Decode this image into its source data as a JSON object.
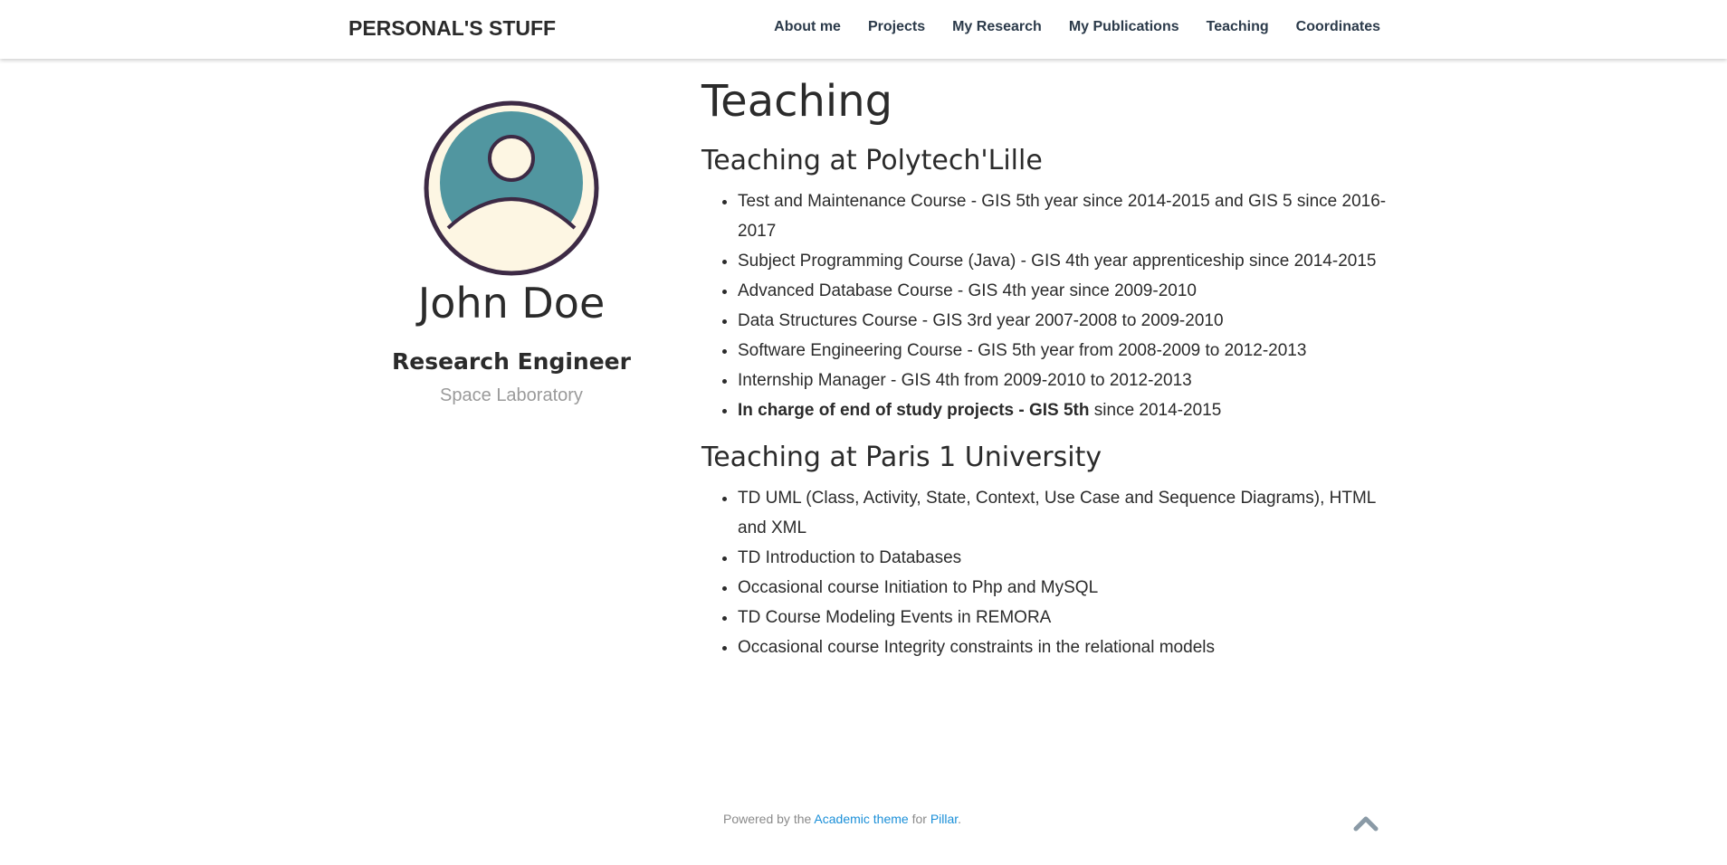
{
  "navbar": {
    "brand": "PERSONAL'S STUFF",
    "links": [
      {
        "label": "About me"
      },
      {
        "label": "Projects"
      },
      {
        "label": "My Research"
      },
      {
        "label": "My Publications"
      },
      {
        "label": "Teaching"
      },
      {
        "label": "Coordinates"
      }
    ]
  },
  "sidebar": {
    "avatar_icon": "user-avatar-icon",
    "name": "John Doe",
    "title": "Research Engineer",
    "organization": "Space Laboratory"
  },
  "content": {
    "title": "Teaching",
    "sections": [
      {
        "heading": "Teaching at Polytech'Lille",
        "items": [
          {
            "bold": "",
            "text": "Test and Maintenance Course - GIS 5th year since 2014-2015 and GIS 5 since 2016-2017"
          },
          {
            "bold": "",
            "text": "Subject Programming Course (Java) - GIS 4th year apprenticeship since 2014-2015"
          },
          {
            "bold": "",
            "text": "Advanced Database Course - GIS 4th year since 2009-2010"
          },
          {
            "bold": "",
            "text": "Data Structures Course - GIS 3rd year 2007-2008 to 2009-2010"
          },
          {
            "bold": "",
            "text": "Software Engineering Course - GIS 5th year from 2008-2009 to 2012-2013"
          },
          {
            "bold": "",
            "text": "Internship Manager - GIS 4th from 2009-2010 to 2012-2013"
          },
          {
            "bold": "In charge of end of study projects - GIS 5th",
            "text": " since 2014-2015"
          }
        ]
      },
      {
        "heading": "Teaching at Paris 1 University",
        "items": [
          {
            "bold": "",
            "text": "TD UML (Class, Activity, State, Context, Use Case and Sequence Diagrams), HTML and XML"
          },
          {
            "bold": "",
            "text": "TD Introduction to Databases"
          },
          {
            "bold": "",
            "text": "Occasional course Initiation to Php and MySQL"
          },
          {
            "bold": "",
            "text": "TD Course Modeling Events in REMORA"
          },
          {
            "bold": "",
            "text": "Occasional course Integrity constraints in the relational models"
          }
        ]
      }
    ]
  },
  "footer": {
    "prefix": "Powered by the ",
    "theme_link": "Academic theme",
    "middle": " for ",
    "pillar_link": "Pillar",
    "suffix": ".",
    "back_to_top_icon": "chevron-up-icon"
  },
  "colors": {
    "avatar_outline": "#3d2a45",
    "avatar_bg": "#fdf6e3",
    "avatar_circle": "#5196a0",
    "link": "#1a8fd8",
    "nav_text": "#2b3a4a"
  }
}
